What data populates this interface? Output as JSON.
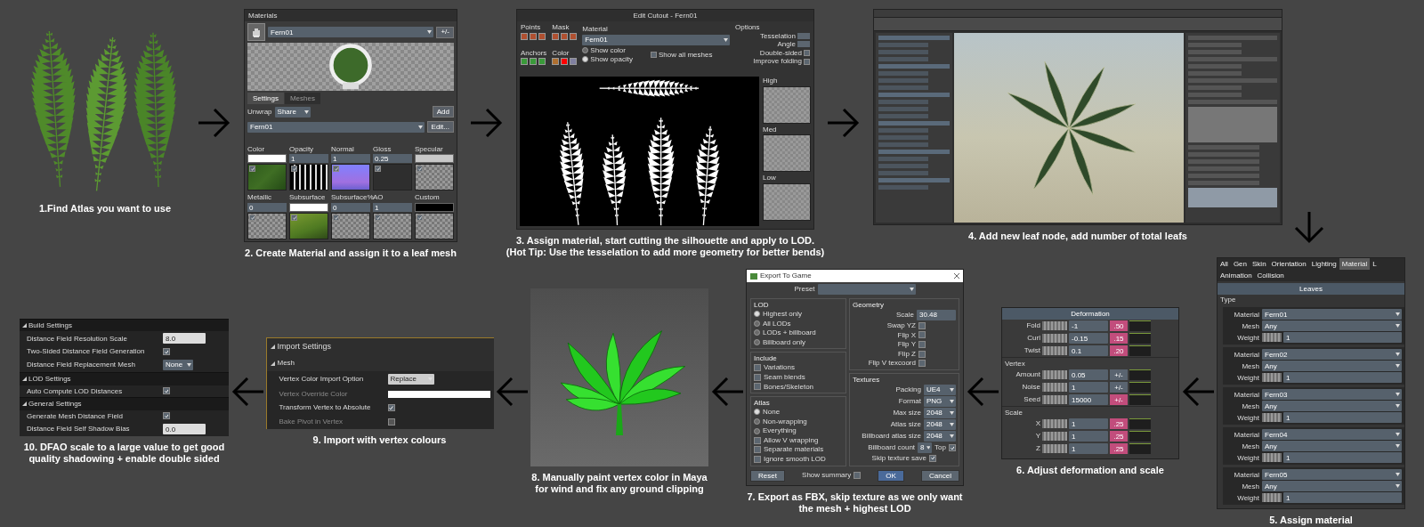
{
  "top_row": [
    {
      "kind": "ferns",
      "caption": [
        "1.Find Atlas you want to use"
      ]
    },
    {
      "kind": "materials",
      "caption": [
        "2. Create Material and assign it to a leaf mesh"
      ],
      "panel": {
        "title": "Materials",
        "material": "Fern01",
        "toggle": "+/-",
        "tabs": [
          {
            "label": "Settings",
            "selected": true
          },
          {
            "label": "Meshes",
            "selected": false
          }
        ],
        "unwrap_label": "Unwrap",
        "unwrap": "Share",
        "add": "Add",
        "mesh": "Fern01",
        "edit": "Edit...",
        "slots": [
          {
            "label": "Color",
            "kind": "swatch",
            "color": "#ffffff",
            "thumbnail": {
              "kind": "leaf"
            },
            "checked": true
          },
          {
            "label": "Opacity",
            "kind": "number",
            "value": "1",
            "thumbnail": {
              "kind": "mask"
            },
            "checked": true
          },
          {
            "label": "Normal",
            "kind": "number",
            "value": "1",
            "thumbnail": {
              "kind": "normal"
            },
            "checked": true
          },
          {
            "label": "Gloss",
            "kind": "number",
            "value": "0.25",
            "thumbnail": {
              "kind": "dark"
            },
            "checked": true
          },
          {
            "label": "Specular",
            "kind": "swatch",
            "color": "#c8c8c8",
            "thumbnail": {
              "kind": "empty"
            },
            "checked": true
          },
          {
            "label": "Metallic",
            "kind": "number",
            "value": "0",
            "thumbnail": {
              "kind": "empty"
            },
            "checked": true
          },
          {
            "label": "Subsurface",
            "kind": "swatch",
            "color": "#ffffff",
            "thumbnail": {
              "kind": "moss"
            },
            "checked": true
          },
          {
            "label": "Subsurface%",
            "kind": "number",
            "value": "0",
            "thumbnail": {
              "kind": "empty"
            },
            "checked": true
          },
          {
            "label": "AO",
            "kind": "number",
            "value": "1",
            "thumbnail": {
              "kind": "empty"
            },
            "checked": true
          },
          {
            "label": "Custom",
            "kind": "swatch",
            "color": "#000000",
            "thumbnail": {
              "kind": "empty"
            },
            "checked": true
          }
        ]
      }
    },
    {
      "kind": "cutout",
      "caption": [
        "3. Assign material, start cutting the silhouette and apply to LOD.",
        "(Hot Tip: Use the tesselation to add more geometry for better bends)"
      ],
      "panel": {
        "title": "Edit Cutout - Fern01",
        "groups": [
          {
            "label": "Points",
            "kind": "tools"
          },
          {
            "label": "Mask",
            "kind": "tools"
          },
          {
            "label": "Anchors",
            "kind": "tools"
          },
          {
            "label": "Color",
            "kind": "color",
            "color": "#ff0000"
          }
        ],
        "material_label": "Material",
        "material": "Fern01",
        "radios": [
          {
            "label": "Show color",
            "selected": false
          },
          {
            "label": "Show opacity",
            "selected": true
          }
        ],
        "show_all": {
          "label": "Show all meshes",
          "checked": false
        },
        "options_title": "Options",
        "options": [
          {
            "label": "Tesselation",
            "kind": "field"
          },
          {
            "label": "Angle",
            "kind": "field"
          },
          {
            "label": "Double-sided",
            "kind": "check",
            "checked": false
          },
          {
            "label": "Improve folding",
            "kind": "check",
            "checked": false
          }
        ],
        "lods": [
          "High",
          "Med",
          "Low"
        ]
      }
    },
    {
      "kind": "leaf_app",
      "caption": [
        "4. Add new leaf node, add number of total leafs"
      ]
    }
  ],
  "bottom_row": [
    {
      "kind": "dfao",
      "caption": [
        "10. DFAO scale to a large value to get good",
        "quality shadowing + enable double sided"
      ],
      "panel": {
        "sections": [
          {
            "title": "Build Settings",
            "rows": [
              {
                "kind": "number",
                "label": "Distance Field Resolution Scale",
                "value": "8.0"
              },
              {
                "kind": "checkbox",
                "label": "Two-Sided Distance Field Generation",
                "checked": true
              },
              {
                "kind": "dropdown",
                "label": "Distance Field Replacement Mesh",
                "value": "None"
              }
            ]
          },
          {
            "title": "LOD Settings",
            "rows": [
              {
                "kind": "checkbox",
                "label": "Auto Compute LOD Distances",
                "checked": true
              }
            ]
          },
          {
            "title": "General Settings",
            "rows": [
              {
                "kind": "checkbox",
                "label": "Generate Mesh Distance Field",
                "checked": true
              },
              {
                "kind": "number",
                "label": "Distance Field Self Shadow Bias",
                "value": "0.0"
              }
            ]
          }
        ]
      }
    },
    {
      "kind": "import",
      "caption": [
        "9. Import with vertex colours"
      ],
      "panel": {
        "title": "Import Settings",
        "section": "Mesh",
        "rows": [
          {
            "kind": "dropdown",
            "label": "Vertex Color Import Option",
            "value": "Replace",
            "disabled": false
          },
          {
            "kind": "color",
            "label": "Vertex Override Color",
            "disabled": true
          },
          {
            "kind": "checkbox",
            "label": "Transform Vertex to Absolute",
            "checked": true,
            "disabled": false
          },
          {
            "kind": "checkbox",
            "label": "Bake Pivot in Vertex",
            "checked": false,
            "disabled": true
          }
        ]
      }
    },
    {
      "kind": "viewport",
      "caption": [
        "8. Manually paint vertex color in Maya",
        "for wind and fix any ground clipping"
      ]
    },
    {
      "kind": "export",
      "caption": [
        "7. Export as FBX, skip texture as we only want",
        "the mesh + highest LOD"
      ],
      "panel": {
        "title": "Export To Game",
        "preset_label": "Preset",
        "lod": {
          "title": "LOD",
          "options": [
            {
              "label": "Highest only",
              "selected": true
            },
            {
              "label": "All LODs",
              "selected": false
            },
            {
              "label": "LODs + billboard",
              "selected": false
            },
            {
              "label": "Billboard only",
              "selected": false
            }
          ]
        },
        "include": {
          "title": "Include",
          "options": [
            {
              "label": "Variations",
              "checked": false
            },
            {
              "label": "Seam blends",
              "checked": false
            },
            {
              "label": "Bones/Skeleton",
              "checked": false
            }
          ]
        },
        "atlas": {
          "title": "Atlas",
          "options": [
            {
              "label": "None",
              "selected": true
            },
            {
              "label": "Non-wrapping",
              "selected": false
            },
            {
              "label": "Everything",
              "selected": false
            }
          ],
          "checks": [
            {
              "label": "Allow V wrapping",
              "checked": false
            },
            {
              "label": "Separate materials",
              "checked": false
            },
            {
              "label": "Ignore smooth LOD",
              "checked": false
            }
          ]
        },
        "geometry": {
          "title": "Geometry",
          "scale_label": "Scale",
          "scale": "30.48",
          "checks": [
            {
              "label": "Swap YZ",
              "checked": false
            },
            {
              "label": "Flip X",
              "checked": false
            },
            {
              "label": "Flip Y",
              "checked": false
            },
            {
              "label": "Flip Z",
              "checked": false
            },
            {
              "label": "Flip V texcoord",
              "checked": false
            }
          ]
        },
        "textures": {
          "title": "Textures",
          "fields": [
            {
              "label": "Packing",
              "value": "UE4"
            },
            {
              "label": "Format",
              "value": "PNG"
            },
            {
              "label": "Max size",
              "value": "2048"
            },
            {
              "label": "Atlas size",
              "value": "2048"
            },
            {
              "label": "Billboard atlas size",
              "value": "2048"
            }
          ],
          "count_label": "Billboard count",
          "count": "8",
          "top_label": "Top",
          "top": true,
          "skip_label": "Skip texture save",
          "skip": true
        },
        "reset": "Reset",
        "summary_label": "Show summary",
        "summary": false,
        "ok": "OK",
        "cancel": "Cancel"
      }
    },
    {
      "kind": "deformation",
      "caption": [
        "6. Adjust deformation and scale"
      ],
      "panel": {
        "header": "Deformation",
        "sections": [
          {
            "rows": [
              {
                "label": "Fold",
                "value": "-1",
                "button": ".50",
                "highlighted": true
              },
              {
                "label": "Curl",
                "value": "-0.15",
                "button": ".15",
                "highlighted": true
              },
              {
                "label": "Twist",
                "value": "0.1",
                "button": ".20",
                "highlighted": true
              }
            ]
          },
          {
            "title": "Vertex",
            "rows": [
              {
                "label": "Amount",
                "value": "0.05",
                "button": "+/-",
                "highlighted": false
              },
              {
                "label": "Noise",
                "value": "1",
                "button": "+/-",
                "highlighted": false
              },
              {
                "label": "Seed",
                "value": "15000",
                "button": "+/-",
                "highlighted": true
              }
            ]
          },
          {
            "title": "Scale",
            "rows": [
              {
                "label": "X",
                "value": "1",
                "button": ".25",
                "highlighted": true
              },
              {
                "label": "Y",
                "value": "1",
                "button": ".25",
                "highlighted": true
              },
              {
                "label": "Z",
                "value": "1",
                "button": ".25",
                "highlighted": true
              }
            ]
          }
        ]
      }
    },
    {
      "kind": "leaf_materials",
      "caption": [
        "5. Assign material"
      ],
      "panel": {
        "tabs": [
          {
            "label": "All",
            "selected": false
          },
          {
            "label": "Gen",
            "selected": false
          },
          {
            "label": "Skin",
            "selected": false
          },
          {
            "label": "Orientation",
            "selected": false
          },
          {
            "label": "Lighting",
            "selected": false
          },
          {
            "label": "Material",
            "selected": true
          },
          {
            "label": "L",
            "selected": false
          },
          {
            "label": "Animation",
            "selected": false
          },
          {
            "label": "Collision",
            "selected": false
          }
        ],
        "header": "Leaves",
        "type_label": "Type",
        "entries": [
          {
            "material_label": "Material",
            "material": "Fern01",
            "mesh_label": "Mesh",
            "mesh": "Any",
            "weight_label": "Weight",
            "weight": "1"
          },
          {
            "material_label": "Material",
            "material": "Fern02",
            "mesh_label": "Mesh",
            "mesh": "Any",
            "weight_label": "Weight",
            "weight": "1"
          },
          {
            "material_label": "Material",
            "material": "Fern03",
            "mesh_label": "Mesh",
            "mesh": "Any",
            "weight_label": "Weight",
            "weight": "1"
          },
          {
            "material_label": "Material",
            "material": "Fern04",
            "mesh_label": "Mesh",
            "mesh": "Any",
            "weight_label": "Weight",
            "weight": "1"
          },
          {
            "material_label": "Material",
            "material": "Fern05",
            "mesh_label": "Mesh",
            "mesh": "Any",
            "weight_label": "Weight",
            "weight": "1"
          }
        ]
      }
    }
  ]
}
